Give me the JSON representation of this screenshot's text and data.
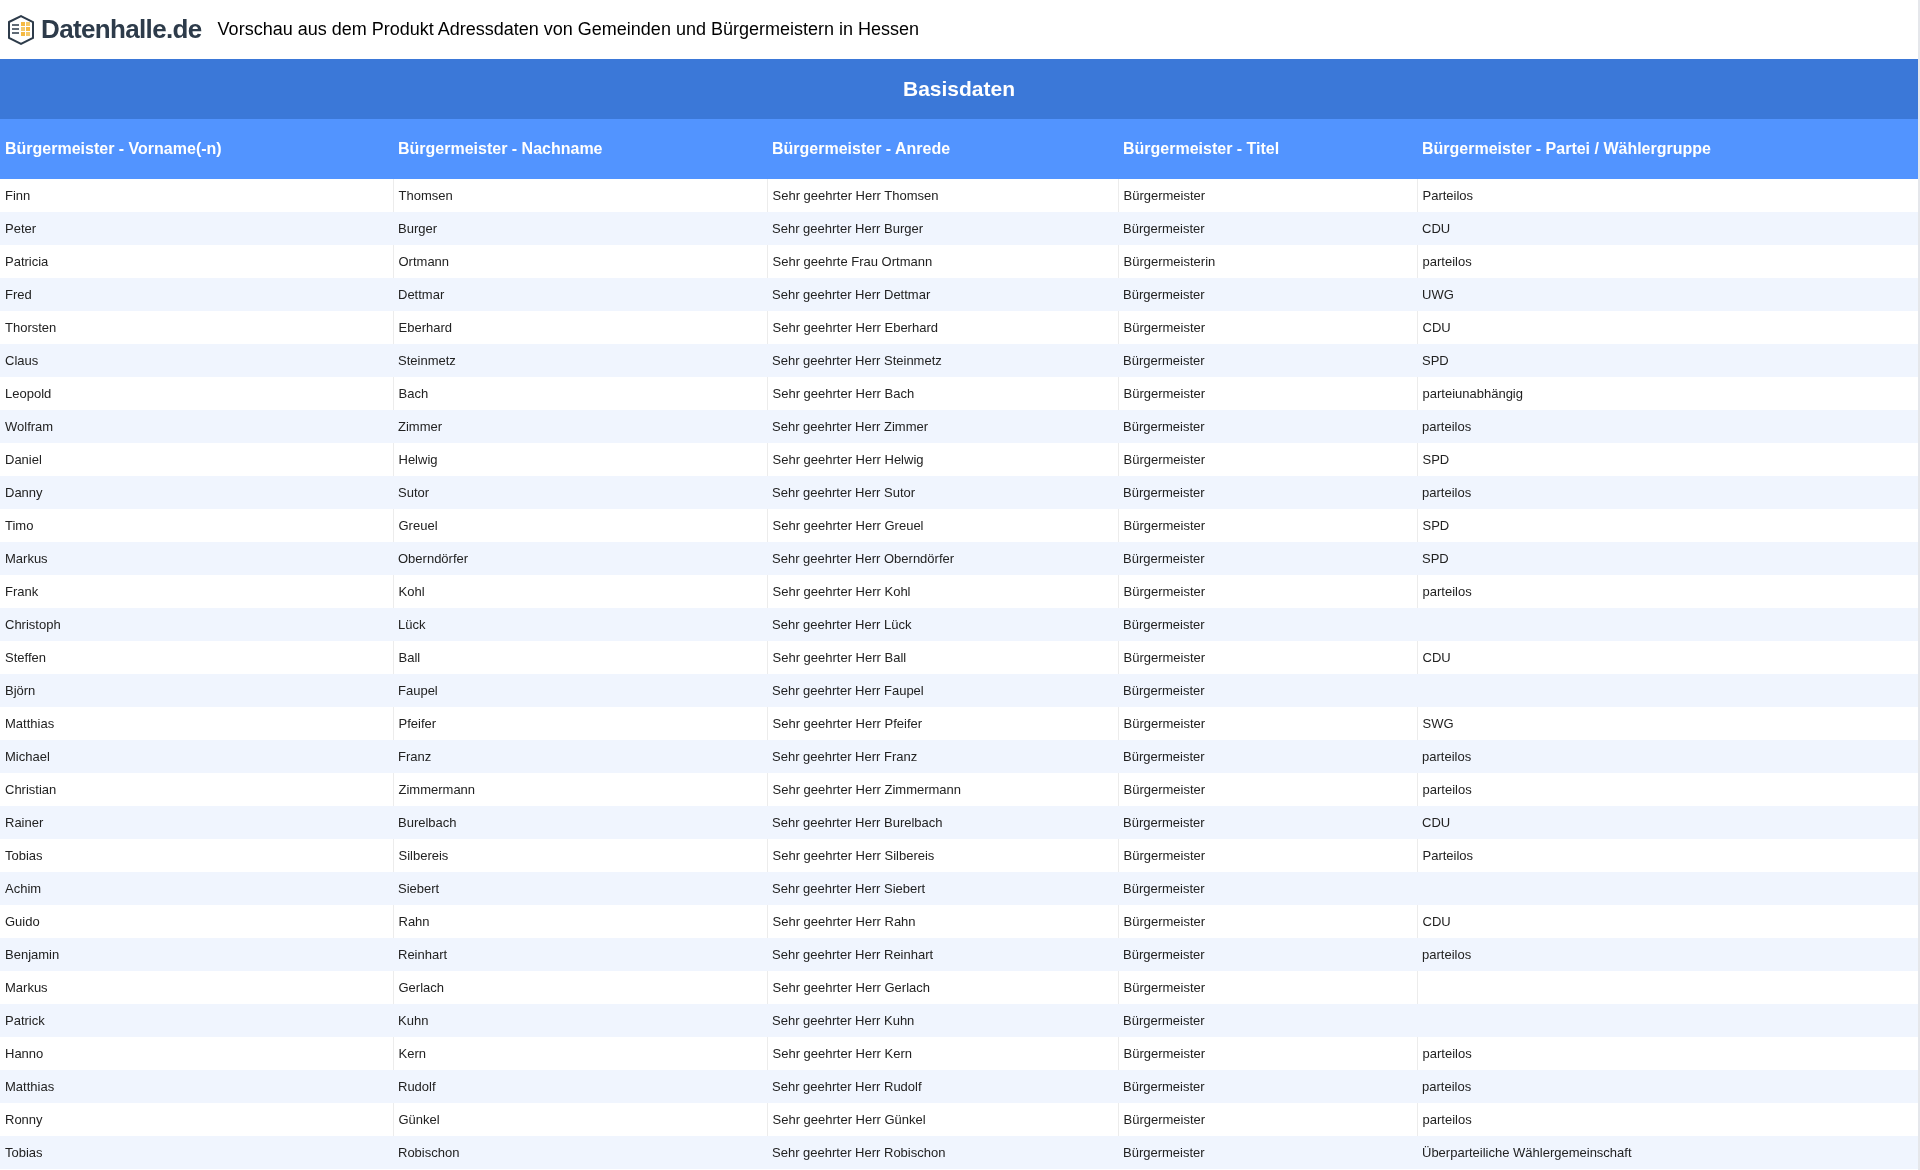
{
  "header": {
    "logo_text": "Datenhalle.de",
    "title": "Vorschau aus dem Produkt Adressdaten von Gemeinden und Bürgermeistern in Hessen"
  },
  "section_title": "Basisdaten",
  "table": {
    "columns": [
      "Bürgermeister - Vorname(-n)",
      "Bürgermeister - Nachname",
      "Bürgermeister - Anrede",
      "Bürgermeister - Titel",
      "Bürgermeister - Partei / Wählergruppe"
    ],
    "rows": [
      {
        "vorname": "Finn",
        "nachname": "Thomsen",
        "anrede": "Sehr geehrter Herr Thomsen",
        "titel": "Bürgermeister",
        "partei": "Parteilos"
      },
      {
        "vorname": "Peter",
        "nachname": "Burger",
        "anrede": "Sehr geehrter Herr Burger",
        "titel": "Bürgermeister",
        "partei": "CDU"
      },
      {
        "vorname": "Patricia",
        "nachname": "Ortmann",
        "anrede": "Sehr geehrte Frau Ortmann",
        "titel": "Bürgermeisterin",
        "partei": "parteilos"
      },
      {
        "vorname": "Fred",
        "nachname": "Dettmar",
        "anrede": "Sehr geehrter Herr Dettmar",
        "titel": "Bürgermeister",
        "partei": "UWG"
      },
      {
        "vorname": "Thorsten",
        "nachname": "Eberhard",
        "anrede": "Sehr geehrter Herr Eberhard",
        "titel": "Bürgermeister",
        "partei": "CDU"
      },
      {
        "vorname": "Claus",
        "nachname": "Steinmetz",
        "anrede": "Sehr geehrter Herr Steinmetz",
        "titel": "Bürgermeister",
        "partei": "SPD"
      },
      {
        "vorname": "Leopold",
        "nachname": "Bach",
        "anrede": "Sehr geehrter Herr Bach",
        "titel": "Bürgermeister",
        "partei": "parteiunabhängig"
      },
      {
        "vorname": "Wolfram",
        "nachname": "Zimmer",
        "anrede": "Sehr geehrter Herr Zimmer",
        "titel": "Bürgermeister",
        "partei": "parteilos"
      },
      {
        "vorname": "Daniel",
        "nachname": "Helwig",
        "anrede": "Sehr geehrter Herr Helwig",
        "titel": "Bürgermeister",
        "partei": "SPD"
      },
      {
        "vorname": "Danny",
        "nachname": "Sutor",
        "anrede": "Sehr geehrter Herr Sutor",
        "titel": "Bürgermeister",
        "partei": "parteilos"
      },
      {
        "vorname": "Timo",
        "nachname": "Greuel",
        "anrede": "Sehr geehrter Herr Greuel",
        "titel": "Bürgermeister",
        "partei": "SPD"
      },
      {
        "vorname": "Markus",
        "nachname": "Oberndörfer",
        "anrede": "Sehr geehrter Herr Oberndörfer",
        "titel": "Bürgermeister",
        "partei": "SPD"
      },
      {
        "vorname": "Frank",
        "nachname": "Kohl",
        "anrede": "Sehr geehrter Herr Kohl",
        "titel": "Bürgermeister",
        "partei": "parteilos"
      },
      {
        "vorname": "Christoph",
        "nachname": "Lück",
        "anrede": "Sehr geehrter Herr Lück",
        "titel": "Bürgermeister"
      },
      {
        "vorname": "Steffen",
        "nachname": "Ball",
        "anrede": "Sehr geehrter Herr Ball",
        "titel": "Bürgermeister",
        "partei": "CDU"
      },
      {
        "vorname": "Björn",
        "nachname": "Faupel",
        "anrede": "Sehr geehrter Herr Faupel",
        "titel": "Bürgermeister"
      },
      {
        "vorname": "Matthias",
        "nachname": "Pfeifer",
        "anrede": "Sehr geehrter Herr Pfeifer",
        "titel": "Bürgermeister",
        "partei": "SWG"
      },
      {
        "vorname": "Michael",
        "nachname": "Franz",
        "anrede": "Sehr geehrter Herr Franz",
        "titel": "Bürgermeister",
        "partei": "parteilos"
      },
      {
        "vorname": "Christian",
        "nachname": "Zimmermann",
        "anrede": "Sehr geehrter Herr Zimmermann",
        "titel": "Bürgermeister",
        "partei": "parteilos"
      },
      {
        "vorname": "Rainer",
        "nachname": "Burelbach",
        "anrede": "Sehr geehrter Herr Burelbach",
        "titel": "Bürgermeister",
        "partei": "CDU"
      },
      {
        "vorname": "Tobias",
        "nachname": "Silbereis",
        "anrede": "Sehr geehrter Herr Silbereis",
        "titel": "Bürgermeister",
        "partei": "Parteilos"
      },
      {
        "vorname": "Achim",
        "nachname": "Siebert",
        "anrede": "Sehr geehrter Herr Siebert",
        "titel": "Bürgermeister"
      },
      {
        "vorname": "Guido",
        "nachname": "Rahn",
        "anrede": "Sehr geehrter Herr Rahn",
        "titel": "Bürgermeister",
        "partei": "CDU"
      },
      {
        "vorname": "Benjamin",
        "nachname": "Reinhart",
        "anrede": "Sehr geehrter Herr Reinhart",
        "titel": "Bürgermeister",
        "partei": "parteilos"
      },
      {
        "vorname": "Markus",
        "nachname": "Gerlach",
        "anrede": "Sehr geehrter Herr Gerlach",
        "titel": "Bürgermeister"
      },
      {
        "vorname": "Patrick",
        "nachname": "Kuhn",
        "anrede": "Sehr geehrter Herr Kuhn",
        "titel": "Bürgermeister"
      },
      {
        "vorname": "Hanno",
        "nachname": "Kern",
        "anrede": "Sehr geehrter Herr Kern",
        "titel": "Bürgermeister",
        "partei": "parteilos"
      },
      {
        "vorname": "Matthias",
        "nachname": "Rudolf",
        "anrede": "Sehr geehrter Herr Rudolf",
        "titel": "Bürgermeister",
        "partei": "parteilos"
      },
      {
        "vorname": "Ronny",
        "nachname": "Günkel",
        "anrede": "Sehr geehrter Herr Günkel",
        "titel": "Bürgermeister",
        "partei": "parteilos"
      },
      {
        "vorname": "Tobias",
        "nachname": "Robischon",
        "anrede": "Sehr geehrter Herr Robischon",
        "titel": "Bürgermeister",
        "partei": "Überparteiliche Wählergemeinschaft"
      }
    ]
  }
}
